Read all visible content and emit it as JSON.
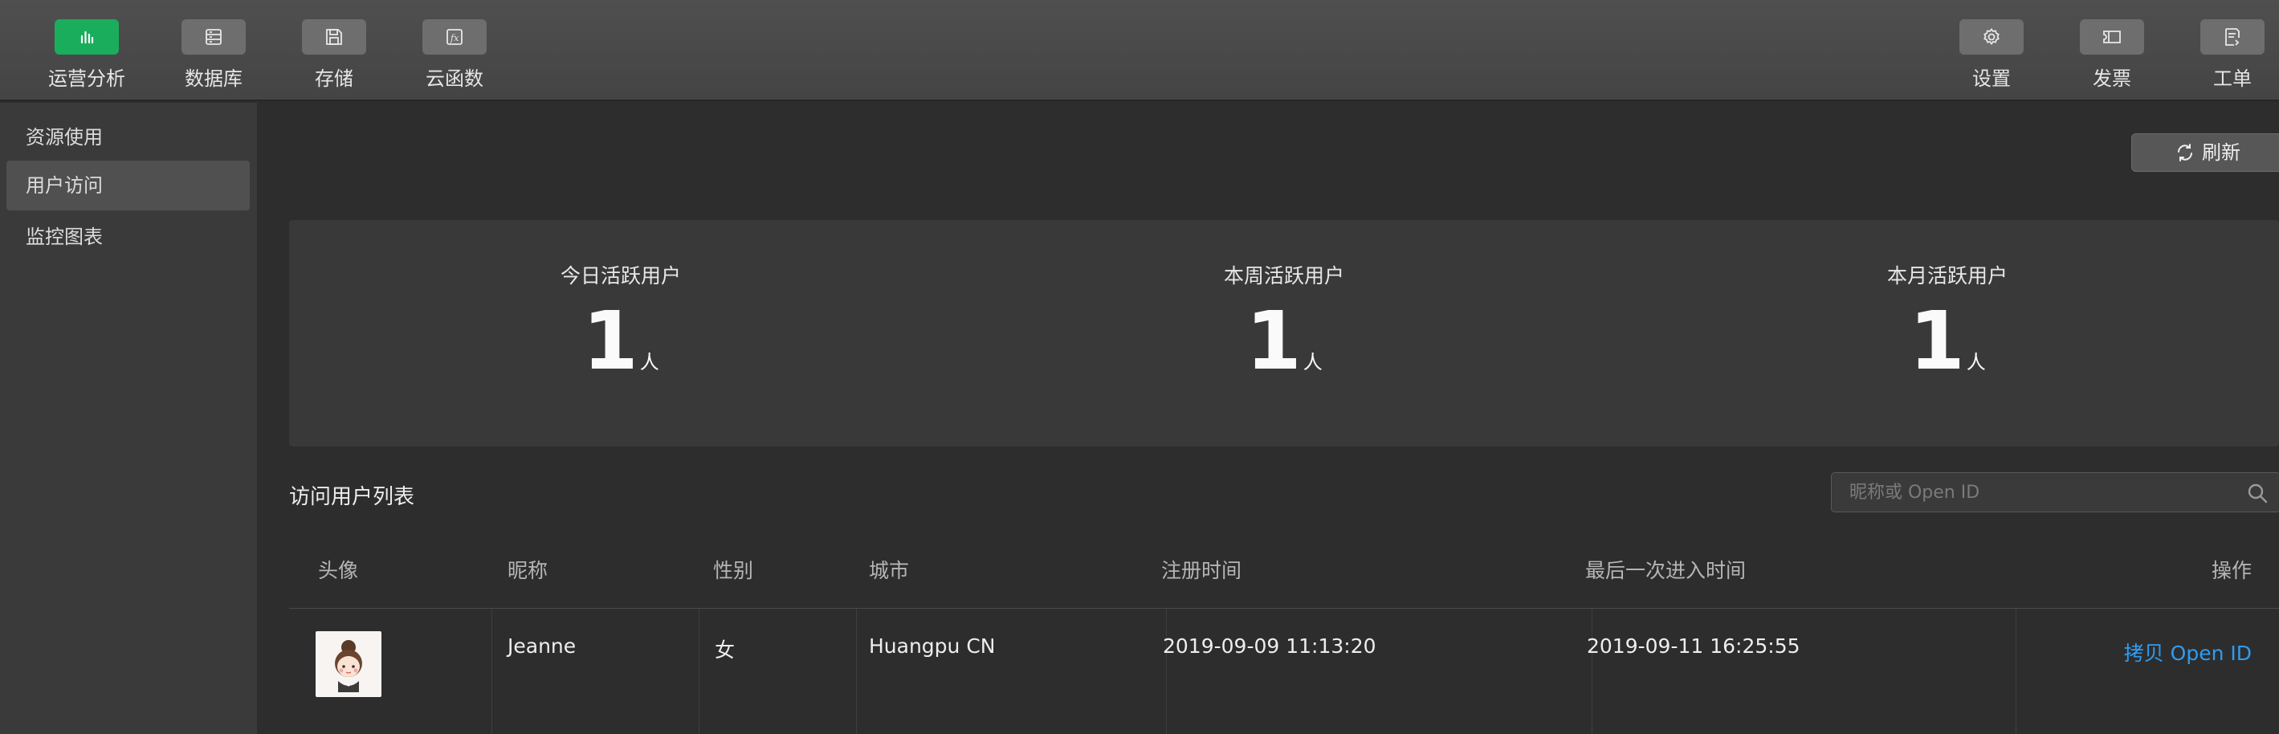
{
  "toolbar": {
    "left": [
      {
        "label": "运营分析",
        "icon": "bar-chart-icon",
        "active": true
      },
      {
        "label": "数据库",
        "icon": "database-icon",
        "active": false
      },
      {
        "label": "存储",
        "icon": "floppy-disk-icon",
        "active": false
      },
      {
        "label": "云函数",
        "icon": "function-icon",
        "active": false
      }
    ],
    "right": [
      {
        "label": "设置",
        "icon": "gear-icon"
      },
      {
        "label": "发票",
        "icon": "ticket-icon"
      },
      {
        "label": "工单",
        "icon": "work-order-icon"
      }
    ]
  },
  "sidebar": {
    "items": [
      {
        "label": "资源使用",
        "active": false
      },
      {
        "label": "用户访问",
        "active": true
      },
      {
        "label": "监控图表",
        "active": false
      }
    ]
  },
  "main": {
    "refresh_label": "刷新",
    "stats": [
      {
        "title": "今日活跃用户",
        "value": "1",
        "unit": "人"
      },
      {
        "title": "本周活跃用户",
        "value": "1",
        "unit": "人"
      },
      {
        "title": "本月活跃用户",
        "value": "1",
        "unit": "人"
      }
    ],
    "list_title": "访问用户列表",
    "search": {
      "placeholder": "昵称或 Open ID"
    },
    "table": {
      "columns": [
        "头像",
        "昵称",
        "性别",
        "城市",
        "注册时间",
        "最后一次进入时间",
        "操作"
      ],
      "rows": [
        {
          "nickname": "Jeanne",
          "gender": "女",
          "city": "Huangpu CN",
          "registered": "2019-09-09 11:13:20",
          "last_visit": "2019-09-11 16:25:55",
          "action": "拷贝 Open ID"
        }
      ]
    }
  },
  "colors": {
    "accent_green": "#1aad5c",
    "link_blue": "#2e9cf0"
  }
}
